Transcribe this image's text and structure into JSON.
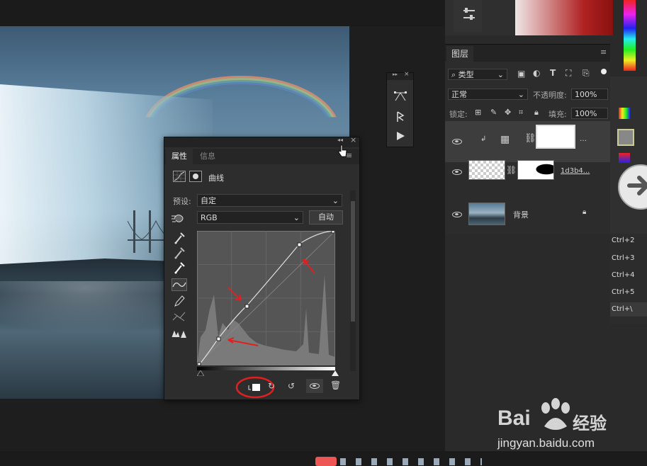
{
  "properties_panel": {
    "tabs": [
      "属性",
      "信息"
    ],
    "adjustment_name": "曲线",
    "preset_label": "预设:",
    "preset_value": "自定",
    "channel_value": "RGB",
    "auto_button": "自动"
  },
  "layers_panel": {
    "tab": "图层",
    "filter_kind": "类型",
    "blend_mode": "正常",
    "opacity_label": "不透明度:",
    "opacity_value": "100%",
    "lock_label": "锁定:",
    "fill_label": "填充:",
    "fill_value": "100%",
    "layers": [
      {
        "name": "",
        "type": "curves-adjustment"
      },
      {
        "name": "1d3b4...",
        "type": "masked-image"
      },
      {
        "name": "背景",
        "type": "background"
      }
    ]
  },
  "shortcuts": [
    "Ctrl+2",
    "Ctrl+3",
    "Ctrl+4",
    "Ctrl+5",
    "Ctrl+\\"
  ],
  "watermark": {
    "brand": "Bai",
    "brand_suffix": "经验",
    "url": "jingyan.baidu.com"
  },
  "colors": {
    "panel_bg": "#2d2d2d",
    "highlight_red": "#e02020"
  }
}
